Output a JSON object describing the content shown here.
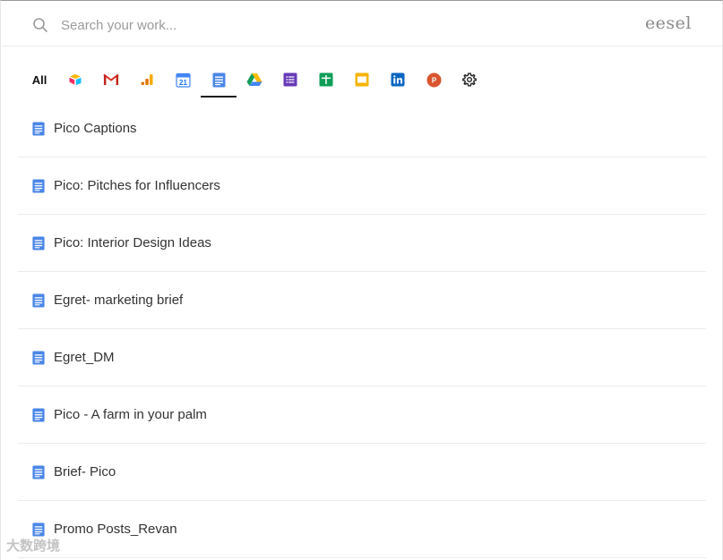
{
  "search": {
    "placeholder": "Search your work...",
    "value": ""
  },
  "brand": "eesel",
  "filters": [
    {
      "label": "All",
      "icon": "all-text",
      "active": false
    },
    {
      "icon": "airtable-icon",
      "active": false
    },
    {
      "icon": "gmail-icon",
      "active": false
    },
    {
      "icon": "analytics-icon",
      "active": false
    },
    {
      "icon": "calendar-icon",
      "label": "21",
      "active": false
    },
    {
      "icon": "google-docs-icon",
      "active": true
    },
    {
      "icon": "google-drive-icon",
      "active": false
    },
    {
      "icon": "google-forms-icon",
      "active": false
    },
    {
      "icon": "google-sheets-icon",
      "active": false
    },
    {
      "icon": "google-slides-icon",
      "active": false
    },
    {
      "icon": "linkedin-icon",
      "active": false
    },
    {
      "icon": "producthunt-icon",
      "label": "P",
      "active": false
    },
    {
      "icon": "gear-icon",
      "active": false
    }
  ],
  "results": [
    {
      "title": "Pico Captions",
      "icon": "google-docs-icon"
    },
    {
      "title": "Pico: Pitches for Influencers",
      "icon": "google-docs-icon"
    },
    {
      "title": "Pico: Interior Design Ideas",
      "icon": "google-docs-icon"
    },
    {
      "title": "Egret- marketing brief",
      "icon": "google-docs-icon"
    },
    {
      "title": "Egret_DM",
      "icon": "google-docs-icon"
    },
    {
      "title": "Pico - A farm in your palm",
      "icon": "google-docs-icon"
    },
    {
      "title": "Brief- Pico",
      "icon": "google-docs-icon"
    },
    {
      "title": "Promo Posts_Revan",
      "icon": "google-docs-icon"
    }
  ],
  "watermark": "大数跨境",
  "colors": {
    "docs_blue": "#4a86e8",
    "active_underline": "#1a1a1a"
  }
}
